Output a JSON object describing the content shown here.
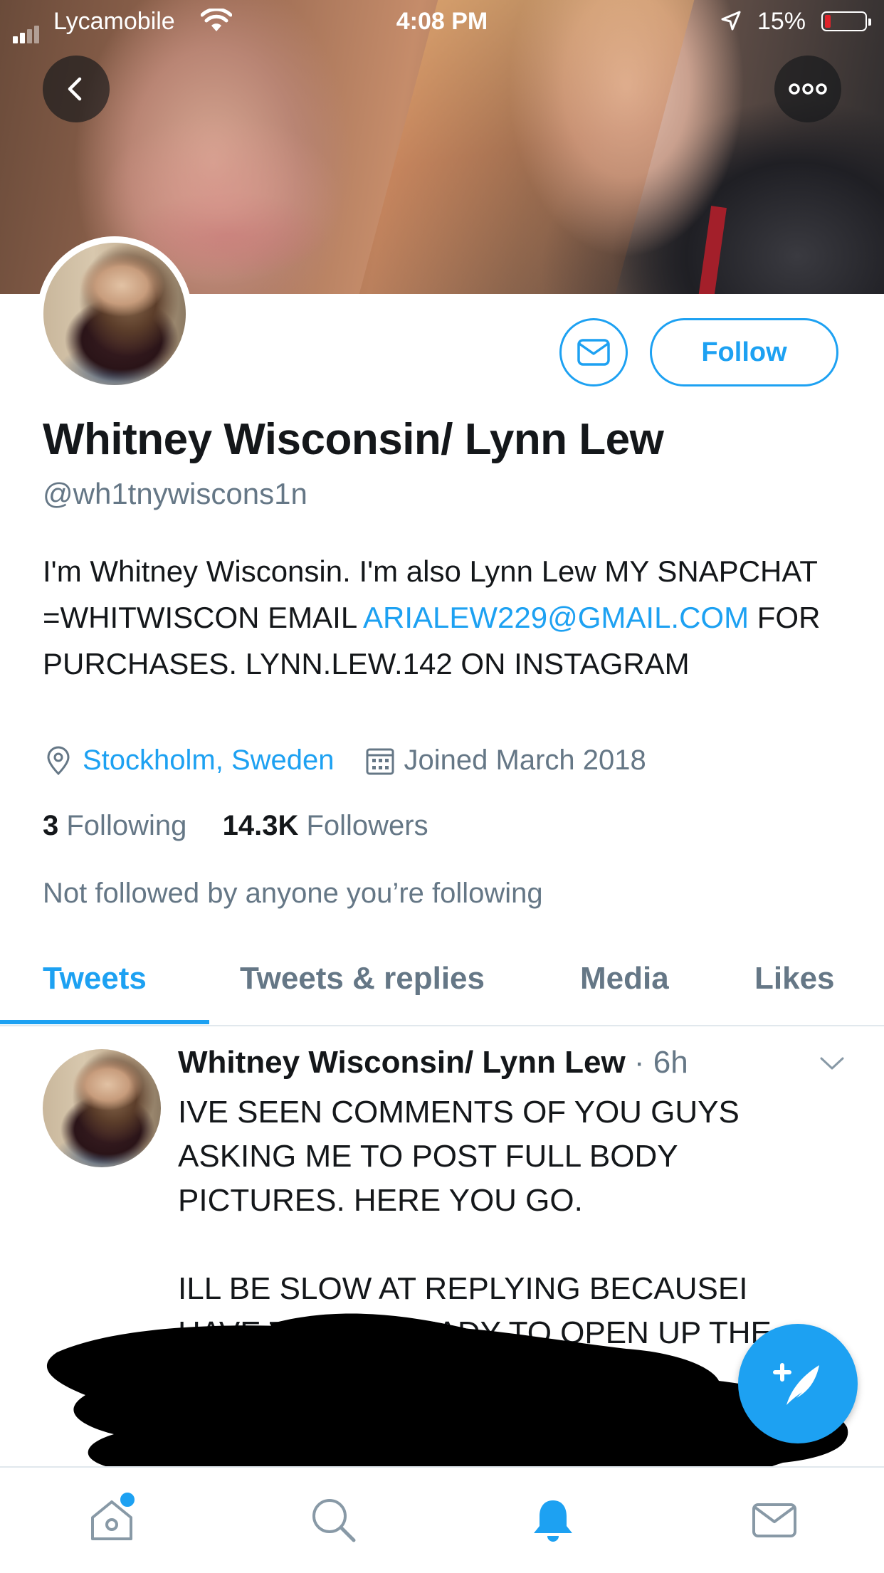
{
  "status_bar": {
    "carrier": "Lycamobile",
    "time": "4:08 PM",
    "battery_percent": "15%"
  },
  "header": {
    "back_icon": "chevron-left-icon",
    "more_icon": "more-horizontal-icon"
  },
  "profile": {
    "follow_label": "Follow",
    "name": "Whitney Wisconsin/ Lynn Lew",
    "handle": "@wh1tnywiscons1n",
    "bio_part1": "I'm Whitney Wisconsin. I'm also Lynn Lew MY SNAPCHAT =WHITWISCON EMAIL ",
    "bio_link": "ARIALEW229@GMAIL.COM",
    "bio_part2": " FOR PURCHASES. LYNN.LEW.142 ON INSTAGRAM",
    "location": "Stockholm, Sweden",
    "joined": "Joined March 2018",
    "following_count": "3",
    "following_label": "Following",
    "followers_count": "14.3K",
    "followers_label": "Followers",
    "not_followed": "Not followed by anyone you’re following"
  },
  "tabs": [
    {
      "label": "Tweets",
      "active": true
    },
    {
      "label": "Tweets & replies",
      "active": false
    },
    {
      "label": "Media",
      "active": false
    },
    {
      "label": "Likes",
      "active": false
    }
  ],
  "tweet": {
    "name": "Whitney Wisconsin/ Lynn Lew",
    "time": " · 6h",
    "text": "IVE SEEN COMMENTS OF YOU GUYS ASKING ME TO POST FULL BODY PICTURES.  HERE YOU GO.\n\nILL BE SLOW AT REPLYING BECAUSEI HAVE TO GET READY TO OPEN UP THE"
  },
  "bottom_nav": [
    "home-icon",
    "search-icon",
    "notifications-icon",
    "messages-icon"
  ],
  "colors": {
    "accent": "#1da1f2",
    "secondary_text": "#657786",
    "primary_text": "#14171a"
  }
}
